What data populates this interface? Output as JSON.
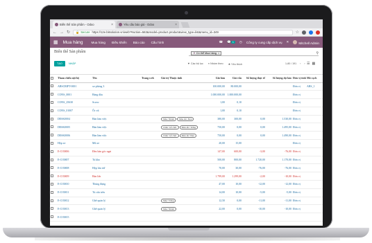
{
  "browser": {
    "tabs": [
      {
        "label": "Biến thể Sản phẩm - Odoo",
        "active": true
      },
      {
        "label": "Yêu cầu báo giá - Odoo",
        "active": false
      }
    ],
    "secure_label": "Secure",
    "url": "https://12e.bitsolution.vn/web?#action=563&model=product.product&view_type=list&menu_id=349"
  },
  "odoo": {
    "module": "Mua hàng",
    "menu": [
      "Mua hàng",
      "Điều khiển",
      "Báo cáo",
      "Cấu hình"
    ],
    "chat_badge": "1",
    "company": "Công ty cung cấp dịch vụ",
    "user": "Mitchell Admin"
  },
  "control": {
    "breadcrumb": "Biến thể Sản phẩm",
    "facet": "Có thể Mua hàng",
    "create_label": "TẠO",
    "import_label": "NHẬP",
    "filters": [
      "Các bộ lọc",
      "Nhóm theo",
      "Yêu thích"
    ],
    "pager": "1-80 / 191"
  },
  "table": {
    "columns": [
      "Tham chiếu nội bộ",
      "Tên",
      "Trang web",
      "Giá trị Thuộc tính",
      "Giá bán",
      "Giá vốn",
      "Số lượng thực tế",
      "Số lượng dự báo",
      "Đơn vị tính",
      "Mã vạch"
    ],
    "rows": [
      {
        "ref": "ABSCRIPT-0001",
        "name": "xe phòng 3",
        "tags": [],
        "price": "100.000,00",
        "cost": "80.000,00",
        "qty": "",
        "forecast": "",
        "uom": "Đơn vị",
        "barcode": "ABS_1",
        "red": false
      },
      {
        "ref": "CONS_0001",
        "name": "Bảng dầu",
        "tags": [],
        "price": "1.000.000,00",
        "cost": "1.000.000,00",
        "qty": "",
        "forecast": "",
        "uom": "Đơn vị",
        "barcode": "",
        "red": false
      },
      {
        "ref": "CONS_25630",
        "name": "Screw",
        "tags": [],
        "price": "1,00",
        "cost": "0,10",
        "qty": "",
        "forecast": "",
        "uom": "Đơn vị",
        "barcode": "",
        "red": false
      },
      {
        "ref": "CONS_01007",
        "name": "Ốc vít",
        "tags": [],
        "price": "1,00",
        "cost": "0,10",
        "qty": "",
        "forecast": "",
        "uom": "Đơn vị",
        "barcode": "",
        "red": false
      },
      {
        "ref": "DESK0004",
        "name": "Bàn làm việc",
        "tags": [
          "Màu: Nhôm",
          "Màu sắc: Đen"
        ],
        "price": "380,00",
        "cost": "300,00",
        "qty": "0,00",
        "forecast": "1.530,00",
        "uom": "Đơn vị",
        "barcode": "",
        "red": false
      },
      {
        "ref": "DESK0005",
        "name": "Bàn làm việc",
        "tags": [
          "Chân: Gỗ chắc",
          "Màu sắc: Trắng"
        ],
        "price": "750,00",
        "cost": "0,00",
        "qty": "0,00",
        "forecast": "1.495,00",
        "uom": "Đơn vị",
        "barcode": "",
        "red": false
      },
      {
        "ref": "DESK0006",
        "name": "Bàn làm việc",
        "tags": [
          "Chân: Gỗ chắc",
          "Màu sắc: Đen"
        ],
        "price": "750,00",
        "cost": "0,00",
        "qty": "0,00",
        "forecast": "1.490,00",
        "uom": "Đơn vị",
        "barcode": "",
        "red": false
      },
      {
        "ref": "Hộp xe",
        "name": "Mũ xe",
        "tags": [],
        "price": "20,00",
        "cost": "15,00",
        "qty": "",
        "forecast": "",
        "uom": "Đơn vị",
        "barcode": "",
        "red": false
      },
      {
        "ref": "E-COM06",
        "name": "Đèn bàn góc ngai",
        "tags": [],
        "price": "147,00",
        "cost": "600,00",
        "qty": "-3,00",
        "forecast": "-76,00",
        "uom": "Đơn vị",
        "barcode": "",
        "red": true
      },
      {
        "ref": "E-COM07",
        "name": "Tủ kho",
        "tags": [],
        "price": "500,00",
        "cost": "800,00",
        "qty": "1.720,00",
        "forecast": "1.170,00",
        "uom": "Đơn vị",
        "barcode": "",
        "red": false
      },
      {
        "ref": "E-COM08",
        "name": "Hộp lưu trữ",
        "tags": [],
        "price": "70,00",
        "cost": "30,00",
        "qty": "-76,00",
        "forecast": "-76,00",
        "uom": "Đơn vị",
        "barcode": "",
        "red": false
      },
      {
        "ref": "E-COM09",
        "name": "Bàn lớn",
        "tags": [],
        "price": "1.799,00",
        "cost": "1.299,00",
        "qty": "-2,00",
        "forecast": "-10,00",
        "uom": "Đơn vị",
        "barcode": "",
        "red": true
      },
      {
        "ref": "E-COM10",
        "name": "Thùng đựng",
        "tags": [],
        "price": "47,00",
        "cost": "10,00",
        "qty": "-12,00",
        "forecast": "-12,00",
        "uom": "Đơn vị",
        "barcode": "",
        "red": false
      },
      {
        "ref": "E-COM11",
        "name": "Tủ cửa trên",
        "tags": [],
        "price": "14,00",
        "cost": "10,00",
        "qty": "-5,00",
        "forecast": "-5,00",
        "uom": "Đơn vị",
        "barcode": "",
        "red": false
      },
      {
        "ref": "E-COM12",
        "name": "Ghế quản lý",
        "tags": [
          "Màu: Trắng"
        ],
        "price": "12,50",
        "cost": "0,00",
        "qty": "-11,00",
        "forecast": "-11,00",
        "uom": "Đơn vị",
        "barcode": "",
        "red": false
      },
      {
        "ref": "E-COM13",
        "name": "Ghế quản lý",
        "tags": [
          "Màu: Nhôm"
        ],
        "price": "22,00",
        "cost": "0,00",
        "qty": "-10,00",
        "forecast": "-10,00",
        "uom": "Đơn vị",
        "barcode": "",
        "red": false
      },
      {
        "ref": "E-COM15",
        "name": "",
        "tags": [],
        "price": "",
        "cost": "",
        "qty": "",
        "forecast": "",
        "uom": "",
        "barcode": "",
        "red": false
      }
    ]
  },
  "colors": {
    "odoo_purple": "#875a7b",
    "teal": "#00a09d",
    "link_blue": "#1b6aa0",
    "negative_red": "#d0312d"
  }
}
